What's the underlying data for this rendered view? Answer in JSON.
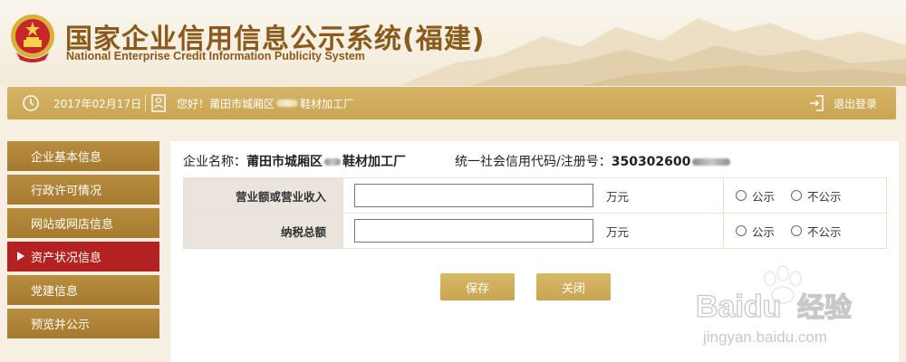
{
  "header": {
    "title_cn": "国家企业信用信息公示系统(福建)",
    "title_en": "National Enterprise Credit Information Publicity System",
    "emblem_icon": "national-emblem-icon"
  },
  "topbar": {
    "date": "2017年02月17日",
    "greeting_prefix": "您好！莆田市城厢区",
    "greeting_suffix": "鞋材加工厂",
    "logout_label": "退出登录"
  },
  "sidebar": {
    "items": [
      {
        "label": "企业基本信息",
        "active": false
      },
      {
        "label": "行政许可情况",
        "active": false
      },
      {
        "label": "网站或网店信息",
        "active": false
      },
      {
        "label": "资产状况信息",
        "active": true
      },
      {
        "label": "党建信息",
        "active": false
      },
      {
        "label": "预览并公示",
        "active": false
      }
    ]
  },
  "company": {
    "name_label": "企业名称：",
    "name_prefix": "莆田市城厢区",
    "name_suffix": "鞋材加工厂",
    "code_label": "统一社会信用代码/注册号：",
    "code_visible": "350302600"
  },
  "form": {
    "rows": [
      {
        "label": "营业额或营业收入",
        "value": "",
        "unit": "万元",
        "opt_public": "公示",
        "opt_private": "不公示"
      },
      {
        "label": "纳税总额",
        "value": "",
        "unit": "万元",
        "opt_public": "公示",
        "opt_private": "不公示"
      }
    ]
  },
  "buttons": {
    "save": "保存",
    "close": "关闭"
  },
  "watermark": {
    "brand": "Baidu",
    "brand_cn": "经验",
    "url": "jingyan.baidu.com"
  },
  "colors": {
    "accent_gold": "#c9a553",
    "sidebar_brown": "#a67a2e",
    "active_red": "#b42121",
    "title_brown": "#8a5a1a"
  }
}
